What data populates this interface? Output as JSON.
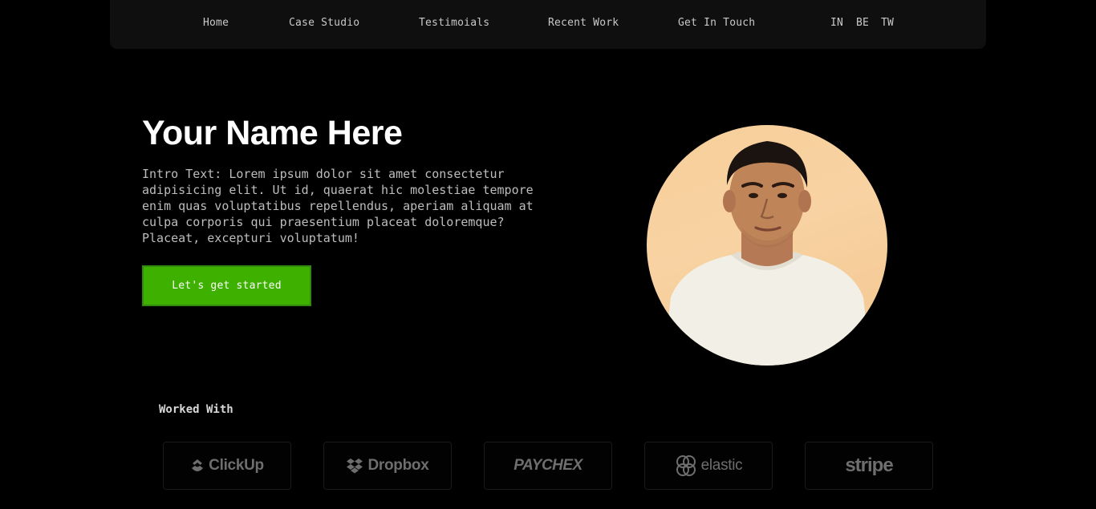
{
  "nav": {
    "links": [
      {
        "label": "Home"
      },
      {
        "label": "Case Studio"
      },
      {
        "label": "Testimoials"
      },
      {
        "label": "Recent Work"
      },
      {
        "label": "Get In Touch"
      }
    ],
    "social": [
      "IN",
      "BE",
      "TW"
    ]
  },
  "hero": {
    "title": "Your Name Here",
    "intro": "Intro Text: Lorem ipsum dolor sit amet consectetur adipisicing elit. Ut id, quaerat hic molestiae tempore enim quas voluptatibus repellendus, aperiam aliquam at culpa corporis qui praesentium placeat doloremque? Placeat, excepturi voluptatum!",
    "cta_label": "Let's get started"
  },
  "worked_with": {
    "title": "Worked With",
    "logos": [
      "ClickUp",
      "Dropbox",
      "PAYCHEX",
      "elastic",
      "stripe"
    ]
  },
  "colors": {
    "background": "#000000",
    "nav_background": "#0f0f0f",
    "accent": "#3eb000",
    "logo_gray": "#6e6e6e"
  },
  "icons": {
    "clickup": "clickup-logo-icon",
    "dropbox": "dropbox-logo-icon",
    "elastic": "elastic-logo-icon"
  }
}
